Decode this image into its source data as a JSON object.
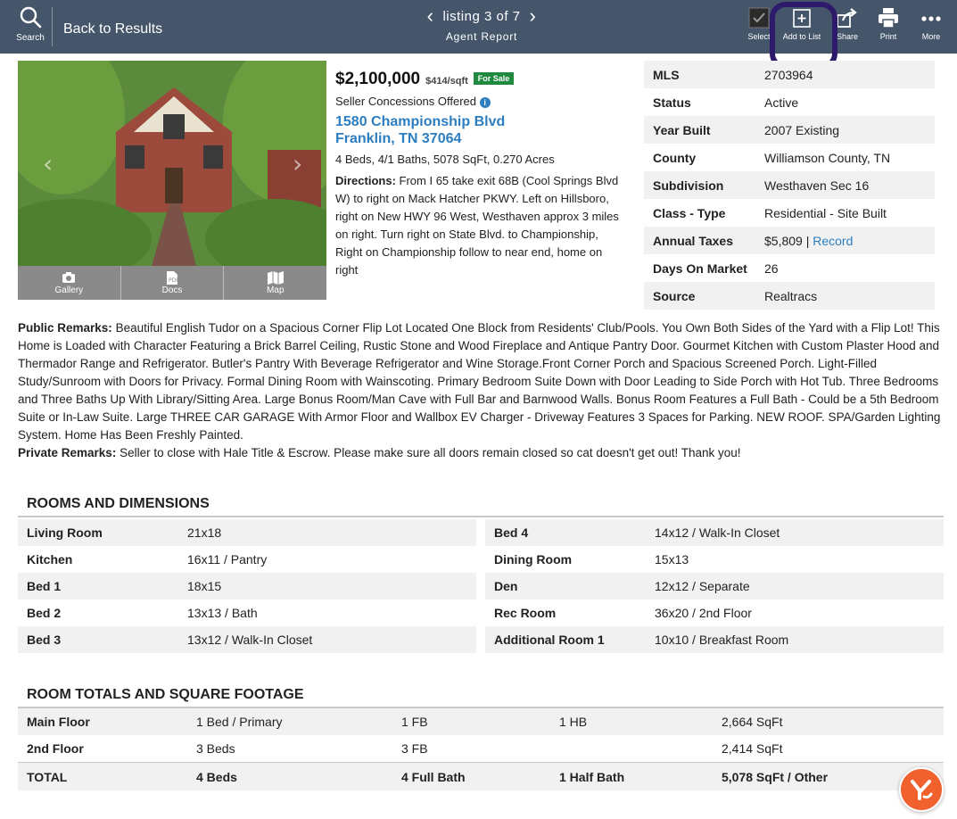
{
  "toolbar": {
    "search_label": "Search",
    "back_label": "Back to Results",
    "listing_text": "listing 3 of 7",
    "report_type": "Agent Report",
    "actions": [
      {
        "label": "Select",
        "icon": "checkbox-icon"
      },
      {
        "label": "Add to List",
        "icon": "add-to-list-icon"
      },
      {
        "label": "Share",
        "icon": "share-icon"
      },
      {
        "label": "Print",
        "icon": "print-icon"
      },
      {
        "label": "More",
        "icon": "more-dots-icon"
      }
    ]
  },
  "photo": {
    "tabs": [
      {
        "label": "Gallery",
        "icon": "camera-icon"
      },
      {
        "label": "Docs",
        "icon": "pdf-icon"
      },
      {
        "label": "Map",
        "icon": "map-icon"
      }
    ]
  },
  "listing": {
    "price": "$2,100,000",
    "price_per_sqft": "$414/sqft",
    "status_badge": "For Sale",
    "concessions": "Seller Concessions Offered",
    "address_line1": "1580 Championship Blvd",
    "address_line2": "Franklin, TN 37064",
    "specs": "4 Beds, 4/1 Baths, 5078 SqFt, 0.270 Acres",
    "directions_label": "Directions:",
    "directions": "From I 65 take exit 68B (Cool Springs Blvd W) to right on Mack Hatcher PKWY. Left on Hillsboro, right on New HWY 96 West, Westhaven approx 3 miles on right. Turn right on State Blvd. to Championship, Right on Championship follow to near end, home on right"
  },
  "facts": [
    {
      "key": "MLS",
      "value": "2703964"
    },
    {
      "key": "Status",
      "value": "Active"
    },
    {
      "key": "Year Built",
      "value": "2007 Existing"
    },
    {
      "key": "County",
      "value": "Williamson County, TN"
    },
    {
      "key": "Subdivision",
      "value": "Westhaven Sec 16"
    },
    {
      "key": "Class - Type",
      "value": "Residential - Site Built"
    },
    {
      "key": "Annual Taxes",
      "value": "$5,809 |",
      "link": "Record"
    },
    {
      "key": "Days On Market",
      "value": "26"
    },
    {
      "key": "Source",
      "value": "Realtracs"
    }
  ],
  "remarks": {
    "public_label": "Public Remarks:",
    "public": "Beautiful English Tudor on a Spacious Corner Flip Lot Located One Block from Residents' Club/Pools. You Own Both Sides of the Yard with a Flip Lot! This Home is Loaded with Character Featuring a Brick Barrel Ceiling, Rustic Stone and Wood Fireplace and Antique Pantry Door. Gourmet Kitchen with Custom Plaster Hood and Thermador Range and Refrigerator. Butler's Pantry With Beverage Refrigerator and Wine Storage.Front Corner Porch and Spacious Screened Porch. Light-Filled Study/Sunroom with Doors for Privacy. Formal Dining Room with Wainscoting. Primary Bedroom Suite Down with Door Leading to Side Porch with Hot Tub. Three Bedrooms and Three Baths Up With Library/Sitting Area. Large Bonus Room/Man Cave with Full Bar and Barnwood Walls. Bonus Room Features a Full Bath - Could be a 5th Bedroom Suite or In-Law Suite. Large THREE CAR GARAGE With Armor Floor and Wallbox EV Charger - Driveway Features 3 Spaces for Parking. NEW ROOF. SPA/Garden Lighting System. Home Has Been Freshly Painted.",
    "private_label": "Private Remarks:",
    "private": "Seller to close with Hale Title & Escrow. Please make sure all doors remain closed so cat doesn't get out! Thank you!"
  },
  "rooms": {
    "title": "ROOMS AND DIMENSIONS",
    "left": [
      {
        "name": "Living Room",
        "dims": "21x18"
      },
      {
        "name": "Kitchen",
        "dims": "16x11 / Pantry"
      },
      {
        "name": "Bed 1",
        "dims": "18x15"
      },
      {
        "name": "Bed 2",
        "dims": "13x13 / Bath"
      },
      {
        "name": "Bed 3",
        "dims": "13x12 / Walk-In Closet"
      }
    ],
    "right": [
      {
        "name": "Bed 4",
        "dims": "14x12 / Walk-In Closet"
      },
      {
        "name": "Dining Room",
        "dims": "15x13"
      },
      {
        "name": "Den",
        "dims": "12x12 / Separate"
      },
      {
        "name": "Rec Room",
        "dims": "36x20 / 2nd Floor"
      },
      {
        "name": "Additional Room 1",
        "dims": "10x10 / Breakfast Room"
      }
    ]
  },
  "totals": {
    "title": "ROOM TOTALS AND SQUARE FOOTAGE",
    "rows": [
      {
        "floor": "Main Floor",
        "beds": "1 Bed / Primary",
        "full": "1 FB",
        "half": "1 HB",
        "sqft": "2,664 SqFt"
      },
      {
        "floor": "2nd Floor",
        "beds": "3 Beds",
        "full": "3 FB",
        "half": "",
        "sqft": "2,414 SqFt"
      },
      {
        "floor": "TOTAL",
        "beds": "4 Beds",
        "full": "4 Full Bath",
        "half": "1 Half Bath",
        "sqft": "5,078 SqFt / Other"
      }
    ]
  },
  "colors": {
    "toolbar_bg": "#45566b",
    "link": "#2c7ec0",
    "badge_green": "#1f8a3f",
    "highlight_ring": "#2e1a6b",
    "fab_orange": "#f0612d"
  }
}
